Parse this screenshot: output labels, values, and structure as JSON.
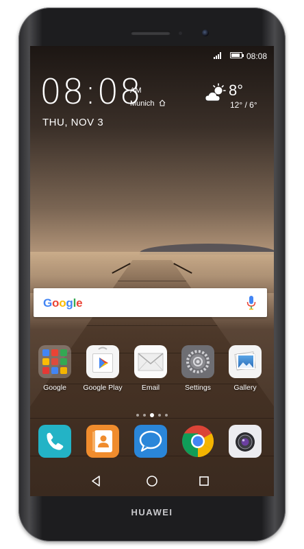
{
  "status_bar": {
    "time": "08:08",
    "battery_level": 0.85
  },
  "clock_widget": {
    "time": "08:08",
    "ampm": "AM",
    "city": "Munich",
    "date": "THU, NOV 3"
  },
  "weather": {
    "temperature": "8°",
    "range": "12° / 6°",
    "icon": "partly-cloudy-icon"
  },
  "search": {
    "brand": "Google",
    "mic_icon": "mic-icon"
  },
  "apps": [
    {
      "label": "Google",
      "icon": "google-folder-icon"
    },
    {
      "label": "Google Play",
      "icon": "play-store-icon"
    },
    {
      "label": "Email",
      "icon": "email-icon"
    },
    {
      "label": "Settings",
      "icon": "settings-gear-icon"
    },
    {
      "label": "Gallery",
      "icon": "gallery-icon"
    }
  ],
  "page_indicator": {
    "count": 5,
    "active_index": 2
  },
  "dock": [
    {
      "name": "phone",
      "icon": "phone-icon",
      "color": "#23b3c6"
    },
    {
      "name": "contacts",
      "icon": "contacts-icon",
      "color": "#f08c2d"
    },
    {
      "name": "messages",
      "icon": "messages-icon",
      "color": "#2a86d9"
    },
    {
      "name": "chrome",
      "icon": "chrome-icon",
      "color": "#dd4b3e"
    },
    {
      "name": "camera",
      "icon": "camera-icon",
      "color": "#e6e6ea"
    }
  ],
  "navigation": [
    "back",
    "home",
    "recents"
  ],
  "device": {
    "brand": "HUAWEI"
  },
  "colors": {
    "google_blue": "#4285F4",
    "google_red": "#EA4335",
    "google_yellow": "#FBBC05",
    "google_green": "#34A853"
  }
}
